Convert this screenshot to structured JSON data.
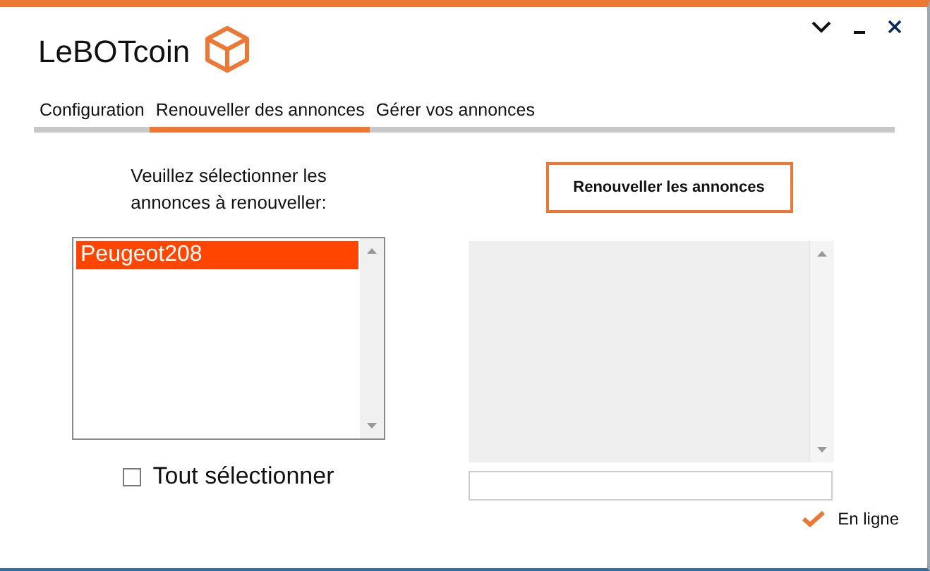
{
  "app": {
    "title": "LeBOTcoin"
  },
  "tabs": [
    {
      "label": "Configuration",
      "selected": false
    },
    {
      "label": "Renouveller des annonces",
      "selected": true
    },
    {
      "label": "Gérer vos annonces",
      "selected": false
    }
  ],
  "left_panel": {
    "prompt": "Veuillez sélectionner les annonces à renouveller:",
    "listings": [
      {
        "label": "Peugeot208",
        "selected": true
      }
    ],
    "select_all": {
      "label": "Tout sélectionner",
      "checked": false
    }
  },
  "right_panel": {
    "button": "Renouveller les annonces",
    "status": {
      "label": "En ligne"
    }
  }
}
